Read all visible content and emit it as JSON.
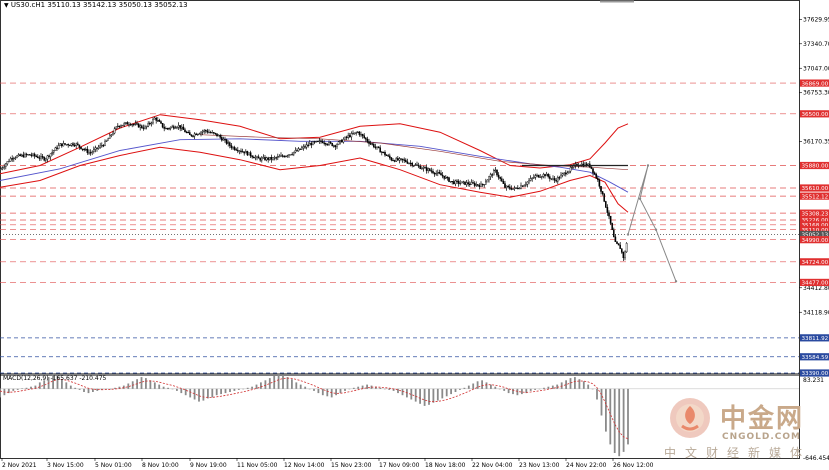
{
  "header": {
    "symbol": "US30.cH1",
    "ohlc": "35110.13 35142.13 35050.13 35052.13",
    "triangle": "▼"
  },
  "macd": {
    "label": "MACD(12,26,9) -165.637 -210.475"
  },
  "price_axis": {
    "ticks": [
      {
        "v": 37629.95,
        "t": "37629.95"
      },
      {
        "v": 37340.7,
        "t": "37340.70"
      },
      {
        "v": 37047.0,
        "t": "37047.00"
      },
      {
        "v": 36753.3,
        "t": "36753.30"
      },
      {
        "v": 36170.35,
        "t": "36170.35"
      },
      {
        "v": 34412.8,
        "t": "34412.80"
      },
      {
        "v": 34118.9,
        "t": "34118.90"
      }
    ],
    "macd_ticks": [
      {
        "v": 83.231,
        "t": "83.231"
      },
      {
        "v": -646.454,
        "t": "-646.454"
      }
    ]
  },
  "levels": [
    {
      "v": 36869.0,
      "t": "36869.00",
      "color": "#e05050"
    },
    {
      "v": 36500.0,
      "t": "36500.00",
      "color": "#e05050"
    },
    {
      "v": 35880.0,
      "t": "35880.00",
      "color": "#e05050"
    },
    {
      "v": 35610.0,
      "t": "35610.00",
      "color": "#e05050"
    },
    {
      "v": 35512.12,
      "t": "35512.12",
      "color": "#e05050"
    },
    {
      "v": 35308.23,
      "t": "35308.23",
      "color": "#e05050"
    },
    {
      "v": 35226.0,
      "t": "35226.00",
      "color": "#e05050"
    },
    {
      "v": 35168.0,
      "t": "35168.00",
      "color": "#e05050"
    },
    {
      "v": 35110.0,
      "t": "35110.00",
      "color": "#e05050"
    },
    {
      "v": 35052.13,
      "t": "35052.13",
      "color": "#444444"
    },
    {
      "v": 34990.0,
      "t": "34990.00",
      "color": "#e05050"
    },
    {
      "v": 34724.0,
      "t": "34724.00",
      "color": "#e05050"
    },
    {
      "v": 34477.0,
      "t": "34477.00",
      "color": "#e05050"
    },
    {
      "v": 33811.92,
      "t": "33811.92",
      "color": "#3050a0"
    },
    {
      "v": 33584.59,
      "t": "33584.59",
      "color": "#3050a0"
    },
    {
      "v": 33390.0,
      "t": "33390.00",
      "color": "#3050a0"
    }
  ],
  "time_axis": [
    "2 Nov 2021",
    "3 Nov 15:00",
    "5 Nov 01:00",
    "8 Nov 10:00",
    "9 Nov 19:00",
    "11 Nov 05:00",
    "12 Nov 14:00",
    "15 Nov 23:00",
    "17 Nov 09:00",
    "18 Nov 18:00",
    "22 Nov 04:00",
    "23 Nov 13:00",
    "24 Nov 22:00",
    "26 Nov 12:00"
  ],
  "chart_data": {
    "type": "candlestick",
    "symbol": "US30.cH1",
    "ylim": [
      33390,
      37770
    ],
    "close_path": [
      [
        0,
        35830
      ],
      [
        12,
        35980
      ],
      [
        30,
        36010
      ],
      [
        45,
        35960
      ],
      [
        60,
        36130
      ],
      [
        75,
        36140
      ],
      [
        90,
        36030
      ],
      [
        105,
        36150
      ],
      [
        118,
        36360
      ],
      [
        130,
        36390
      ],
      [
        145,
        36330
      ],
      [
        155,
        36450
      ],
      [
        165,
        36320
      ],
      [
        178,
        36360
      ],
      [
        190,
        36240
      ],
      [
        205,
        36300
      ],
      [
        218,
        36240
      ],
      [
        232,
        36100
      ],
      [
        245,
        36040
      ],
      [
        258,
        35960
      ],
      [
        272,
        35960
      ],
      [
        285,
        36000
      ],
      [
        298,
        36060
      ],
      [
        310,
        36140
      ],
      [
        322,
        36170
      ],
      [
        335,
        36120
      ],
      [
        348,
        36230
      ],
      [
        358,
        36280
      ],
      [
        368,
        36170
      ],
      [
        380,
        36060
      ],
      [
        392,
        35950
      ],
      [
        404,
        35940
      ],
      [
        418,
        35870
      ],
      [
        430,
        35820
      ],
      [
        442,
        35760
      ],
      [
        452,
        35680
      ],
      [
        462,
        35670
      ],
      [
        472,
        35660
      ],
      [
        482,
        35640
      ],
      [
        495,
        35820
      ],
      [
        505,
        35620
      ],
      [
        515,
        35600
      ],
      [
        525,
        35660
      ],
      [
        535,
        35750
      ],
      [
        545,
        35770
      ],
      [
        555,
        35700
      ],
      [
        565,
        35790
      ],
      [
        578,
        35900
      ],
      [
        590,
        35880
      ],
      [
        598,
        35700
      ],
      [
        604,
        35470
      ],
      [
        610,
        35210
      ],
      [
        615,
        34950
      ],
      [
        620,
        34900
      ],
      [
        624,
        34760
      ],
      [
        628,
        35060
      ]
    ],
    "bb_upper": [
      [
        0,
        35780
      ],
      [
        40,
        35880
      ],
      [
        80,
        36100
      ],
      [
        120,
        36330
      ],
      [
        160,
        36490
      ],
      [
        200,
        36430
      ],
      [
        240,
        36350
      ],
      [
        280,
        36200
      ],
      [
        320,
        36220
      ],
      [
        360,
        36350
      ],
      [
        400,
        36380
      ],
      [
        440,
        36280
      ],
      [
        480,
        36060
      ],
      [
        510,
        35880
      ],
      [
        540,
        35850
      ],
      [
        570,
        35890
      ],
      [
        590,
        35960
      ],
      [
        605,
        36150
      ],
      [
        618,
        36330
      ],
      [
        628,
        36380
      ]
    ],
    "bb_lower": [
      [
        0,
        35620
      ],
      [
        40,
        35700
      ],
      [
        80,
        35880
      ],
      [
        120,
        36000
      ],
      [
        160,
        36100
      ],
      [
        200,
        36040
      ],
      [
        240,
        35950
      ],
      [
        280,
        35830
      ],
      [
        320,
        35880
      ],
      [
        360,
        35970
      ],
      [
        400,
        35830
      ],
      [
        440,
        35650
      ],
      [
        480,
        35560
      ],
      [
        510,
        35500
      ],
      [
        540,
        35570
      ],
      [
        570,
        35700
      ],
      [
        590,
        35760
      ],
      [
        605,
        35680
      ],
      [
        618,
        35420
      ],
      [
        628,
        35320
      ]
    ],
    "ma": [
      [
        0,
        35700
      ],
      [
        60,
        35840
      ],
      [
        120,
        36060
      ],
      [
        180,
        36190
      ],
      [
        240,
        36200
      ],
      [
        300,
        36170
      ],
      [
        360,
        36170
      ],
      [
        420,
        36110
      ],
      [
        480,
        35990
      ],
      [
        530,
        35900
      ],
      [
        560,
        35860
      ],
      [
        590,
        35800
      ],
      [
        610,
        35680
      ],
      [
        628,
        35560
      ]
    ],
    "ma2": [
      [
        200,
        36250
      ],
      [
        260,
        36220
      ],
      [
        320,
        36200
      ],
      [
        380,
        36150
      ],
      [
        440,
        36050
      ],
      [
        500,
        35930
      ],
      [
        550,
        35880
      ],
      [
        590,
        35860
      ],
      [
        628,
        35830
      ]
    ],
    "projection": [
      [
        628,
        35052
      ],
      [
        648,
        35880
      ],
      [
        640,
        35480
      ],
      [
        656,
        35110
      ],
      [
        676,
        34490
      ]
    ],
    "macd_hist": [
      -80,
      -60,
      -40,
      -20,
      -10,
      5,
      10,
      20,
      30,
      60,
      80,
      110,
      140,
      120,
      90,
      60,
      30,
      10,
      -10,
      -30,
      -40,
      -30,
      -20,
      -10,
      -5,
      0,
      10,
      20,
      30,
      50,
      70,
      90,
      110,
      100,
      80,
      60,
      40,
      20,
      10,
      0,
      -20,
      -40,
      -60,
      -80,
      -100,
      -120,
      -110,
      -90,
      -80,
      -60,
      -50,
      -40,
      -30,
      -20,
      -10,
      0,
      10,
      20,
      40,
      60,
      80,
      100,
      120,
      140,
      130,
      110,
      90,
      60,
      40,
      20,
      0,
      -20,
      -40,
      -60,
      -70,
      -80,
      -60,
      -40,
      -20,
      0,
      10,
      20,
      30,
      40,
      30,
      20,
      10,
      0,
      -10,
      -20,
      -40,
      -60,
      -80,
      -100,
      -120,
      -140,
      -160,
      -150,
      -130,
      -110,
      -90,
      -70,
      -50,
      -30,
      -10,
      10,
      30,
      50,
      70,
      80,
      60,
      40,
      20,
      0,
      -20,
      -40,
      -50,
      -60,
      -50,
      -40,
      -20,
      -10,
      0,
      10,
      20,
      30,
      40,
      60,
      80,
      100,
      110,
      90,
      70,
      40,
      0,
      -100,
      -250,
      -400,
      -520,
      -600,
      -630,
      -590,
      -520
    ],
    "macd_ylim": [
      -646.454,
      120
    ]
  },
  "watermark": {
    "title": "中金网",
    "url": "CNGOLD.COM",
    "subtitle": "中文财经新媒体"
  },
  "colors": {
    "bb": "#dd1010",
    "ma": "#5555cc",
    "ma2": "#9a3a3a",
    "candle": "#000000",
    "grid": "#888888"
  }
}
